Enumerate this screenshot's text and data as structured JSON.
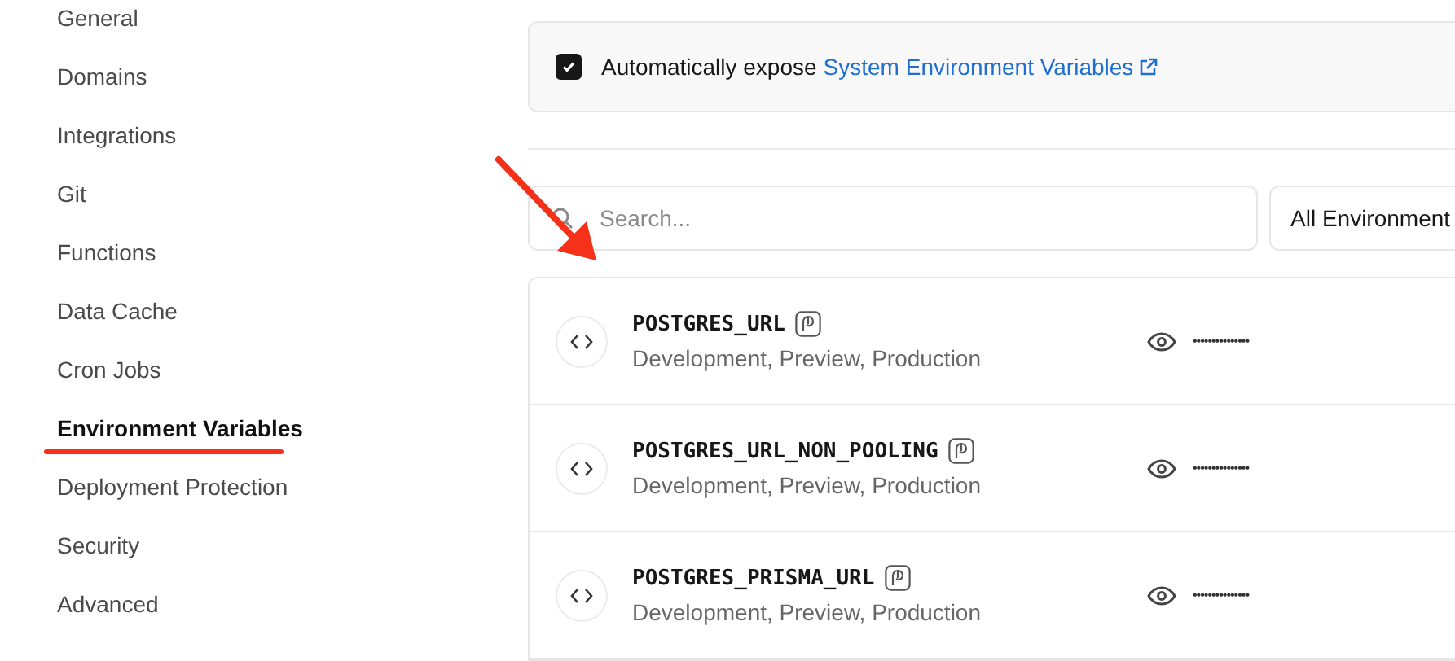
{
  "sidebar": {
    "items": [
      {
        "label": "General",
        "selected": false
      },
      {
        "label": "Domains",
        "selected": false
      },
      {
        "label": "Integrations",
        "selected": false
      },
      {
        "label": "Git",
        "selected": false
      },
      {
        "label": "Functions",
        "selected": false
      },
      {
        "label": "Data Cache",
        "selected": false
      },
      {
        "label": "Cron Jobs",
        "selected": false
      },
      {
        "label": "Environment Variables",
        "selected": true
      },
      {
        "label": "Deployment Protection",
        "selected": false
      },
      {
        "label": "Security",
        "selected": false
      },
      {
        "label": "Advanced",
        "selected": false
      }
    ]
  },
  "expose_option": {
    "checked": true,
    "label": "Automatically expose",
    "link": "System Environment Variables"
  },
  "search": {
    "placeholder": "Search..."
  },
  "environment_filter": {
    "value": "All Environment"
  },
  "variables": [
    {
      "name": "POSTGRES_URL",
      "environments": "Development, Preview, Production",
      "value": "•••••••••••••••"
    },
    {
      "name": "POSTGRES_URL_NON_POOLING",
      "environments": "Development, Preview, Production",
      "value": "•••••••••••••••"
    },
    {
      "name": "POSTGRES_PRISMA_URL",
      "environments": "Development, Preview, Production",
      "value": "•••••••••••••••"
    }
  ]
}
